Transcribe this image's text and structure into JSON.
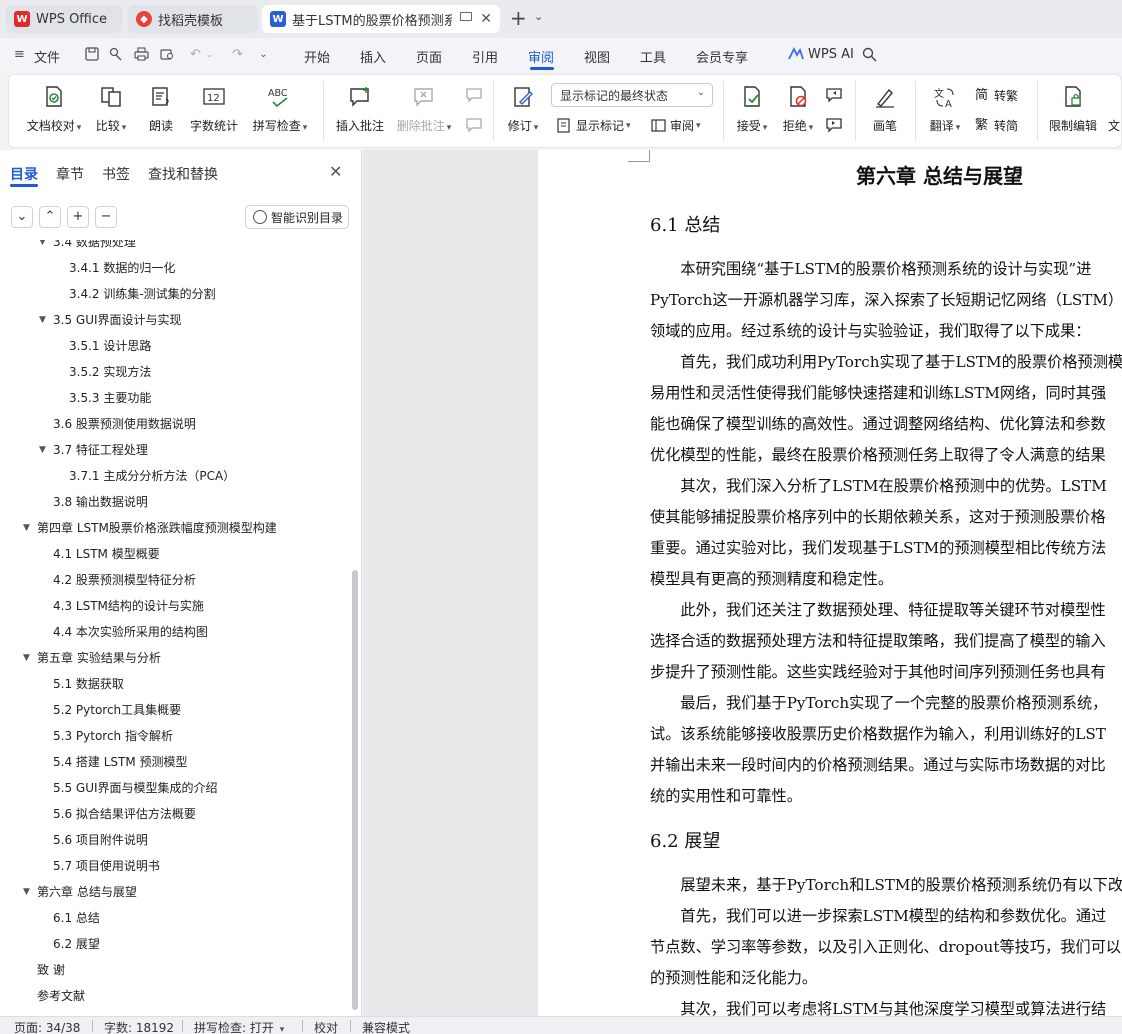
{
  "tabs": [
    {
      "label": "WPS Office"
    },
    {
      "label": "找稻壳模板"
    },
    {
      "label": "基于LSTM的股票价格预测系统"
    }
  ],
  "menu": {
    "file": "文件",
    "items": [
      "开始",
      "插入",
      "页面",
      "引用",
      "审阅",
      "视图",
      "工具",
      "会员专享"
    ],
    "active": "审阅",
    "wps_ai": "WPS AI"
  },
  "ribbon": {
    "doc_check": "文档校对",
    "compare": "比较",
    "read_aloud": "朗读",
    "word_count": "字数统计",
    "spell_check": "拼写检查",
    "insert_comment": "插入批注",
    "delete_comment": "删除批注",
    "track_changes": "修订",
    "markup_mode": "显示标记的最终状态",
    "show_markup": "显示标记",
    "review": "审阅",
    "accept": "接受",
    "reject": "拒绝",
    "pen": "画笔",
    "translate": "翻译",
    "to_traditional": "转繁",
    "to_simplified": "转简",
    "restrict_edit": "限制编辑",
    "more": "文"
  },
  "sidebar": {
    "tabs": [
      "目录",
      "章节",
      "书签",
      "查找和替换"
    ],
    "smart_toc": "智能识别目录",
    "toc": [
      {
        "level": 2,
        "label": "3.4 数据预处理",
        "expand": true
      },
      {
        "level": 3,
        "label": "3.4.1 数据的归一化",
        "expand": false
      },
      {
        "level": 3,
        "label": "3.4.2 训练集-测试集的分割",
        "expand": false
      },
      {
        "level": 2,
        "label": "3.5 GUI界面设计与实现",
        "expand": true
      },
      {
        "level": 3,
        "label": "3.5.1 设计思路",
        "expand": false
      },
      {
        "level": 3,
        "label": "3.5.2 实现方法",
        "expand": false
      },
      {
        "level": 3,
        "label": "3.5.3 主要功能",
        "expand": false
      },
      {
        "level": 2,
        "label": "3.6 股票预测使用数据说明",
        "expand": false
      },
      {
        "level": 2,
        "label": "3.7 特征工程处理",
        "expand": true
      },
      {
        "level": 3,
        "label": "3.7.1 主成分分析方法（PCA）",
        "expand": false
      },
      {
        "level": 2,
        "label": "3.8 输出数据说明",
        "expand": false
      },
      {
        "level": 1,
        "label": "第四章 LSTM股票价格涨跌幅度预测模型构建",
        "expand": true
      },
      {
        "level": 2,
        "label": "4.1 LSTM 模型概要",
        "expand": false
      },
      {
        "level": 2,
        "label": "4.2 股票预测模型特征分析",
        "expand": false
      },
      {
        "level": 2,
        "label": "4.3 LSTM结构的设计与实施",
        "expand": false
      },
      {
        "level": 2,
        "label": "4.4 本次实验所采用的结构图",
        "expand": false
      },
      {
        "level": 1,
        "label": "第五章 实验结果与分析",
        "expand": true
      },
      {
        "level": 2,
        "label": "5.1 数据获取",
        "expand": false
      },
      {
        "level": 2,
        "label": "5.2 Pytorch工具集概要",
        "expand": false
      },
      {
        "level": 2,
        "label": "5.3 Pytorch 指令解析",
        "expand": false
      },
      {
        "level": 2,
        "label": "5.4 搭建 LSTM 预测模型",
        "expand": false
      },
      {
        "level": 2,
        "label": "5.5 GUI界面与模型集成的介绍",
        "expand": false
      },
      {
        "level": 2,
        "label": "5.6 拟合结果评估方法概要",
        "expand": false
      },
      {
        "level": 2,
        "label": "5.6 项目附件说明",
        "expand": false
      },
      {
        "level": 2,
        "label": "5.7 项目使用说明书",
        "expand": false
      },
      {
        "level": 1,
        "label": "第六章 总结与展望",
        "expand": true
      },
      {
        "level": 2,
        "label": "6.1 总结",
        "expand": false
      },
      {
        "level": 2,
        "label": "6.2 展望",
        "expand": false
      },
      {
        "level": 1,
        "label": "致  谢",
        "expand": false
      },
      {
        "level": 1,
        "label": "参考文献",
        "expand": false
      }
    ]
  },
  "document": {
    "chapter_title": "第六章 总结与展望",
    "sec1_title": "6.1 总结",
    "sec1_lines": [
      "　　本研究围绕“基于LSTM的股票价格预测系统的设计与实现”进",
      "PyTorch这一开源机器学习库，深入探索了长短期记忆网络（LSTM）",
      "领域的应用。经过系统的设计与实验验证，我们取得了以下成果：",
      "　　首先，我们成功利用PyTorch实现了基于LSTM的股票价格预测模",
      "易用性和灵活性使得我们能够快速搭建和训练LSTM网络，同时其强",
      "能也确保了模型训练的高效性。通过调整网络结构、优化算法和参数",
      "优化模型的性能，最终在股票价格预测任务上取得了令人满意的结果",
      "　　其次，我们深入分析了LSTM在股票价格预测中的优势。LSTM",
      "使其能够捕捉股票价格序列中的长期依赖关系，这对于预测股票价格",
      "重要。通过实验对比，我们发现基于LSTM的预测模型相比传统方法",
      "模型具有更高的预测精度和稳定性。",
      "　　此外，我们还关注了数据预处理、特征提取等关键环节对模型性",
      "选择合适的数据预处理方法和特征提取策略，我们提高了模型的输入",
      "步提升了预测性能。这些实践经验对于其他时间序列预测任务也具有",
      "　　最后，我们基于PyTorch实现了一个完整的股票价格预测系统，",
      "试。该系统能够接收股票历史价格数据作为输入，利用训练好的LST",
      "并输出未来一段时间内的价格预测结果。通过与实际市场数据的对比",
      "统的实用性和可靠性。"
    ],
    "sec2_title": "6.2 展望",
    "sec2_lines": [
      "　　展望未来，基于PyTorch和LSTM的股票价格预测系统仍有以下改",
      "　　首先，我们可以进一步探索LSTM模型的结构和参数优化。通过",
      "节点数、学习率等参数，以及引入正则化、dropout等技巧，我们可以",
      "的预测性能和泛化能力。",
      "　　其次，我们可以考虑将LSTM与其他深度学习模型或算法进行结"
    ]
  },
  "status": {
    "page": "页面: 34/38",
    "words": "字数: 18192",
    "spell": "拼写检查: 打开",
    "proof": "校对",
    "compat": "兼容模式"
  },
  "colors": {
    "accent": "#1f5bd6",
    "wps_red": "#e02b2b",
    "doc_blue": "#2b5fd9"
  }
}
